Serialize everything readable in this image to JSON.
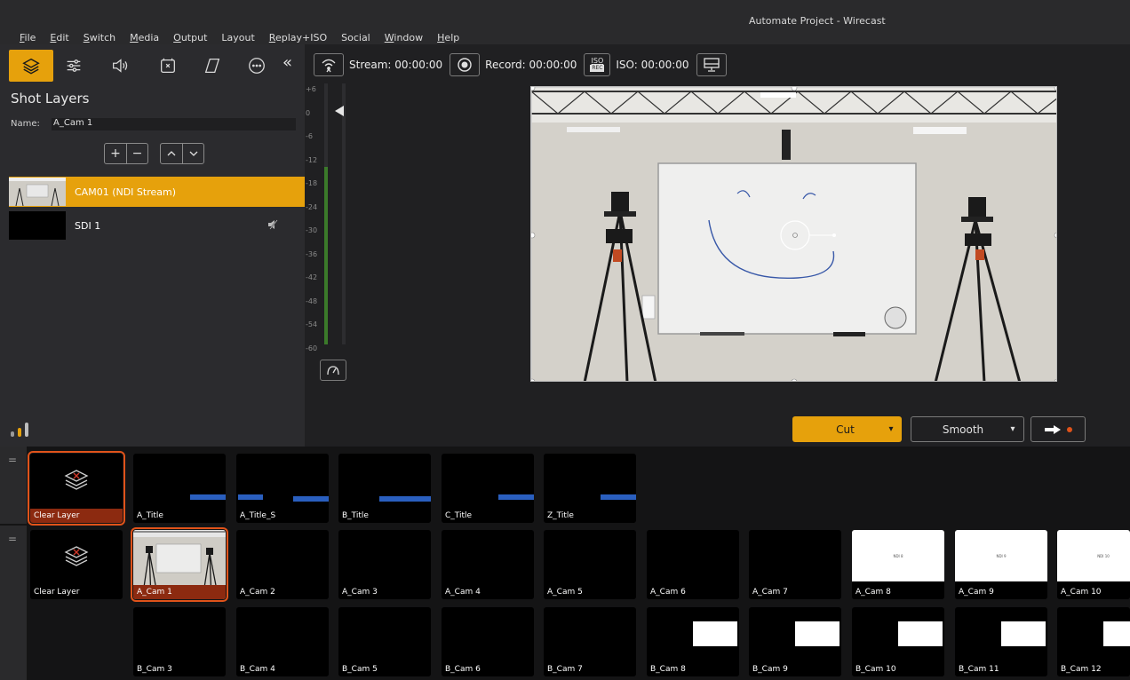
{
  "window": {
    "title": "Automate Project - Wirecast"
  },
  "menu": [
    {
      "label": "File",
      "u": "F",
      "rest": "ile"
    },
    {
      "label": "Edit",
      "u": "E",
      "rest": "dit"
    },
    {
      "label": "Switch",
      "u": "S",
      "rest": "witch"
    },
    {
      "label": "Media",
      "u": "M",
      "rest": "edia"
    },
    {
      "label": "Output",
      "u": "O",
      "rest": "utput"
    },
    {
      "label": "Layout",
      "u": "",
      "rest": "Layout"
    },
    {
      "label": "Replay+ISO",
      "u": "R",
      "rest": "eplay+ISO"
    },
    {
      "label": "Social",
      "u": "",
      "rest": "Social"
    },
    {
      "label": "Window",
      "u": "W",
      "rest": "indow"
    },
    {
      "label": "Help",
      "u": "H",
      "rest": "elp"
    }
  ],
  "toolbar": {
    "tools": [
      "layers-icon",
      "properties-icon",
      "audio-icon",
      "effects-icon",
      "transform-icon",
      "more-icon"
    ],
    "collapse": "«"
  },
  "shot_layers": {
    "title": "Shot Layers",
    "name_label": "Name:",
    "name_value": "A_Cam 1",
    "add": "+",
    "remove": "−",
    "up": "^",
    "down": "v",
    "layers": [
      {
        "label": "CAM01 (NDI Stream)",
        "active": true
      },
      {
        "label": "SDI 1",
        "active": false
      }
    ]
  },
  "status": {
    "stream": "Stream: 00:00:00",
    "record": "Record: 00:00:00",
    "iso": "ISO: 00:00:00",
    "iso_badge_top": "ISO",
    "iso_badge_bottom": "REC"
  },
  "meter": {
    "ticks": [
      "+6",
      "0",
      "-6",
      "-12",
      "-18",
      "-24",
      "-30",
      "-36",
      "-42",
      "-48",
      "-54",
      "-60"
    ]
  },
  "transition": {
    "cut": "Cut",
    "smooth": "Smooth",
    "cut_caret": "▾",
    "smooth_caret": "▾"
  },
  "shots_row1": [
    {
      "label": "Clear Layer"
    },
    {
      "label": "A_Title"
    },
    {
      "label": "A_Title_S"
    },
    {
      "label": "B_Title"
    },
    {
      "label": "C_Title"
    },
    {
      "label": "Z_Title"
    }
  ],
  "shots_row2": [
    {
      "label": "Clear Layer"
    },
    {
      "label": "A_Cam 1"
    },
    {
      "label": "A_Cam 2"
    },
    {
      "label": "A_Cam 3"
    },
    {
      "label": "A_Cam 4"
    },
    {
      "label": "A_Cam 5"
    },
    {
      "label": "A_Cam 6"
    },
    {
      "label": "A_Cam 7"
    },
    {
      "label": "A_Cam 8",
      "ndi": "NDI 8"
    },
    {
      "label": "A_Cam 9",
      "ndi": "NDI 9"
    },
    {
      "label": "A_Cam 10",
      "ndi": "NDI 10"
    }
  ],
  "shots_row3": [
    {
      "label": "B_Cam 3"
    },
    {
      "label": "B_Cam 4"
    },
    {
      "label": "B_Cam 5"
    },
    {
      "label": "B_Cam 6"
    },
    {
      "label": "B_Cam 7"
    },
    {
      "label": "B_Cam 8"
    },
    {
      "label": "B_Cam 9"
    },
    {
      "label": "B_Cam 10"
    },
    {
      "label": "B_Cam 11"
    },
    {
      "label": "B_Cam 12"
    }
  ],
  "colors": {
    "accent": "#e6a10c",
    "selection": "#e0531a",
    "title_bar": "#2a5fbf"
  }
}
